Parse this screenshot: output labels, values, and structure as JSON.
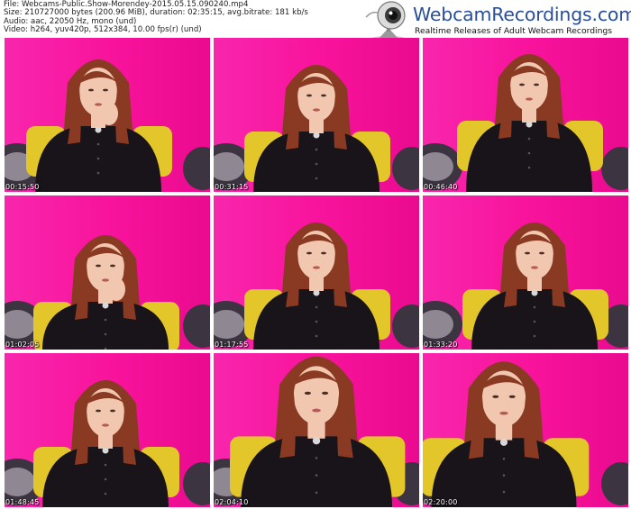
{
  "header": {
    "file_line": "File: Webcams-Public.Show-Morendey-2015.05.15.090240.mp4",
    "size_line": "Size: 210727000 bytes (200.96 MiB), duration: 02:35:15, avg.bitrate: 181 kb/s",
    "audio_line": "Audio: aac, 22050 Hz, mono (und)",
    "video_line": "Video: h264, yuv420p, 512x384, 10.00 fps(r) (und)"
  },
  "brand": {
    "title": "WebcamRecordings.com",
    "subtitle": "Realtime Releases of Adult Webcam Recordings",
    "icon": "webcam-icon",
    "title_color": "#2a4f96"
  },
  "thumbnails": [
    {
      "timestamp": "00:15:50"
    },
    {
      "timestamp": "00:31:15"
    },
    {
      "timestamp": "00:46:40"
    },
    {
      "timestamp": "01:02:05"
    },
    {
      "timestamp": "01:17:55"
    },
    {
      "timestamp": "01:33:20"
    },
    {
      "timestamp": "01:48:45"
    },
    {
      "timestamp": "02:04:10"
    },
    {
      "timestamp": "02:20:00"
    }
  ],
  "colors": {
    "backdrop": "#f5109a",
    "hair": "#8a3a22",
    "blouse": "#18141a",
    "pillow": "#e3c62a",
    "skin": "#f1c7b0"
  }
}
